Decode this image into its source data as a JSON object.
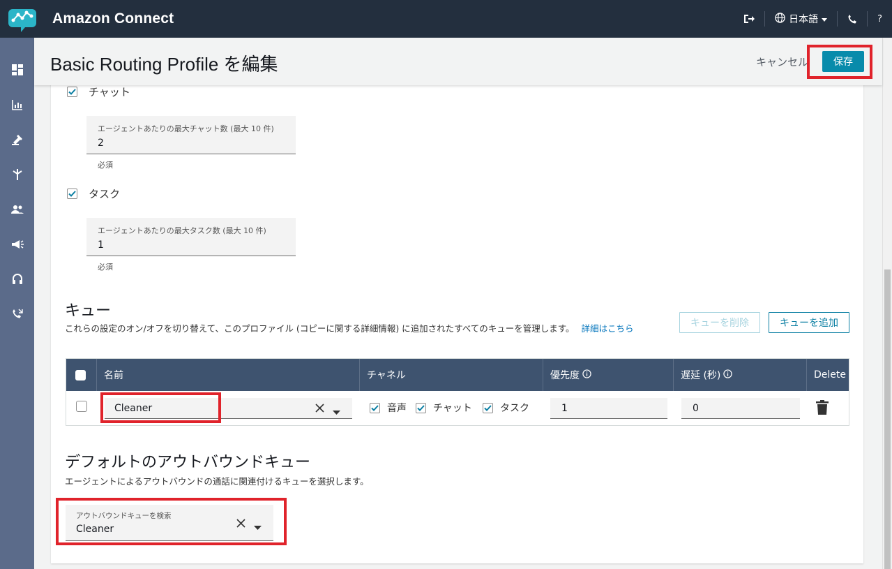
{
  "topbar": {
    "app_title": "Amazon Connect",
    "language": "日本語",
    "help": "?"
  },
  "header": {
    "page_title": "Basic Routing Profile を編集",
    "cancel_label": "キャンセル",
    "save_label": "保存"
  },
  "channels": {
    "chat": {
      "label": "チャット",
      "checked": true,
      "field_label": "エージェントあたりの最大チャット数 (最大 10 件)",
      "field_value": "2",
      "helper": "必須"
    },
    "task": {
      "label": "タスク",
      "checked": true,
      "field_label": "エージェントあたりの最大タスク数 (最大 10 件)",
      "field_value": "1",
      "helper": "必須"
    }
  },
  "queues": {
    "title": "キュー",
    "description": "これらの設定のオン/オフを切り替えて、このプロファイル (コピーに関する詳細情報) に追加されたすべてのキューを管理します。",
    "details_link": "詳細はこちら",
    "remove_button": "キューを削除",
    "add_button": "キューを追加",
    "columns": {
      "name": "名前",
      "channel": "チャネル",
      "priority": "優先度",
      "delay": "遅延 (秒)",
      "delete": "Delete"
    },
    "rows": [
      {
        "name": "Cleaner",
        "voice": "音声",
        "chat": "チャット",
        "task": "タスク",
        "priority": "1",
        "delay": "0"
      }
    ]
  },
  "outbound": {
    "title": "デフォルトのアウトバウンドキュー",
    "description": "エージェントによるアウトバウンドの通話に関連付けるキューを選択します。",
    "field_label": "アウトバウンドキューを検索",
    "field_value": "Cleaner"
  },
  "colors": {
    "topbar": "#232f3e",
    "sidebar": "#5b6b8a",
    "primary": "#088bab",
    "table_header": "#3e536f",
    "highlight": "#e0232b"
  }
}
